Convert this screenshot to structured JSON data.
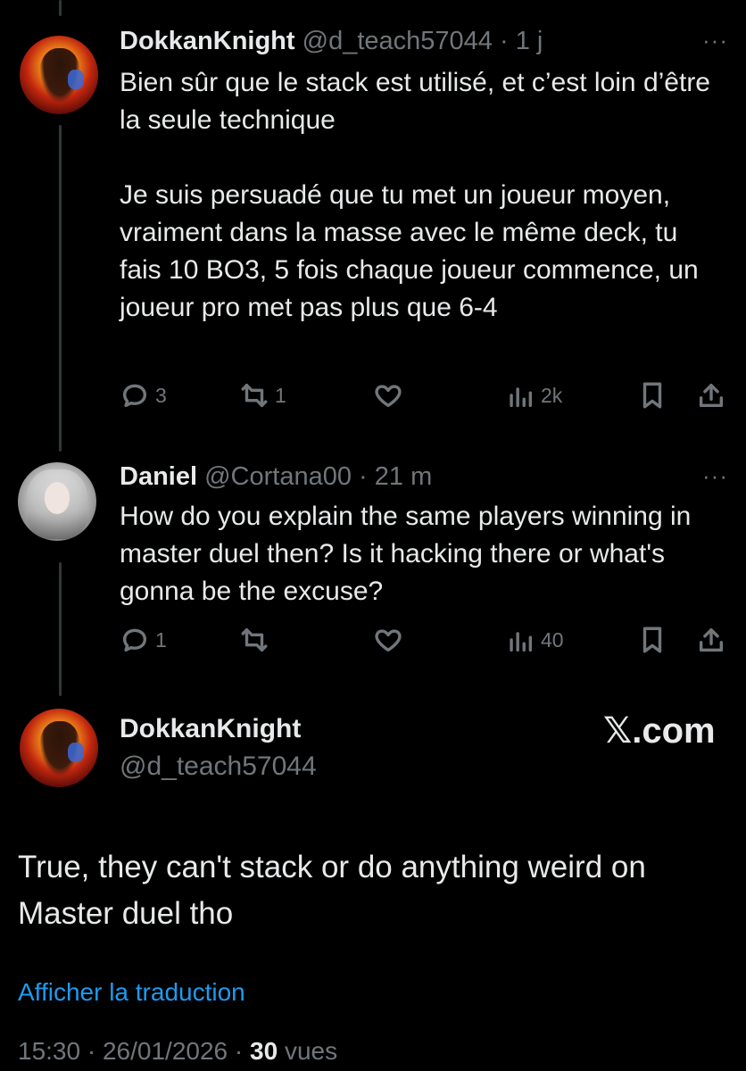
{
  "tweets": [
    {
      "display_name": "DokkanKnight",
      "handle": "@d_teach57044",
      "separator": " · ",
      "time": "1 j",
      "more": "···",
      "text": "Bien sûr que le stack est utilisé, et c’est loin d’être la seule technique\n\nJe suis persuadé que tu met un joueur moyen, vraiment dans la masse avec le même deck, tu fais 10 BO3, 5 fois chaque joueur commence, un joueur pro met pas plus que 6-4",
      "reply_count": "3",
      "retweet_count": "1",
      "like_count": "",
      "views": "2k"
    },
    {
      "display_name": "Daniel",
      "handle": "@Cortana00",
      "separator": " · ",
      "time": "21 m",
      "more": "···",
      "text": "How do you explain the same players winning in master duel then? Is it hacking there or what's gonna be the excuse?",
      "reply_count": "1",
      "retweet_count": "",
      "like_count": "",
      "views": "40"
    }
  ],
  "main_tweet": {
    "display_name": "DokkanKnight",
    "handle": "@d_teach57044",
    "text": "True, they can't stack or do anything weird on Master duel tho",
    "translate_link": "Afficher la traduction",
    "time": "15:30",
    "date": "26/01/2026",
    "views_count": "30",
    "views_label": "vues",
    "dot": " · "
  },
  "watermark": "𝕏.com",
  "icons": {
    "reply": "reply-icon",
    "retweet": "retweet-icon",
    "like": "heart-icon",
    "views": "views-icon",
    "bookmark": "bookmark-icon",
    "share": "share-icon"
  },
  "colors": {
    "background": "#000000",
    "text": "#e7e9ea",
    "muted": "#71767b",
    "link": "#1d9bf0"
  }
}
